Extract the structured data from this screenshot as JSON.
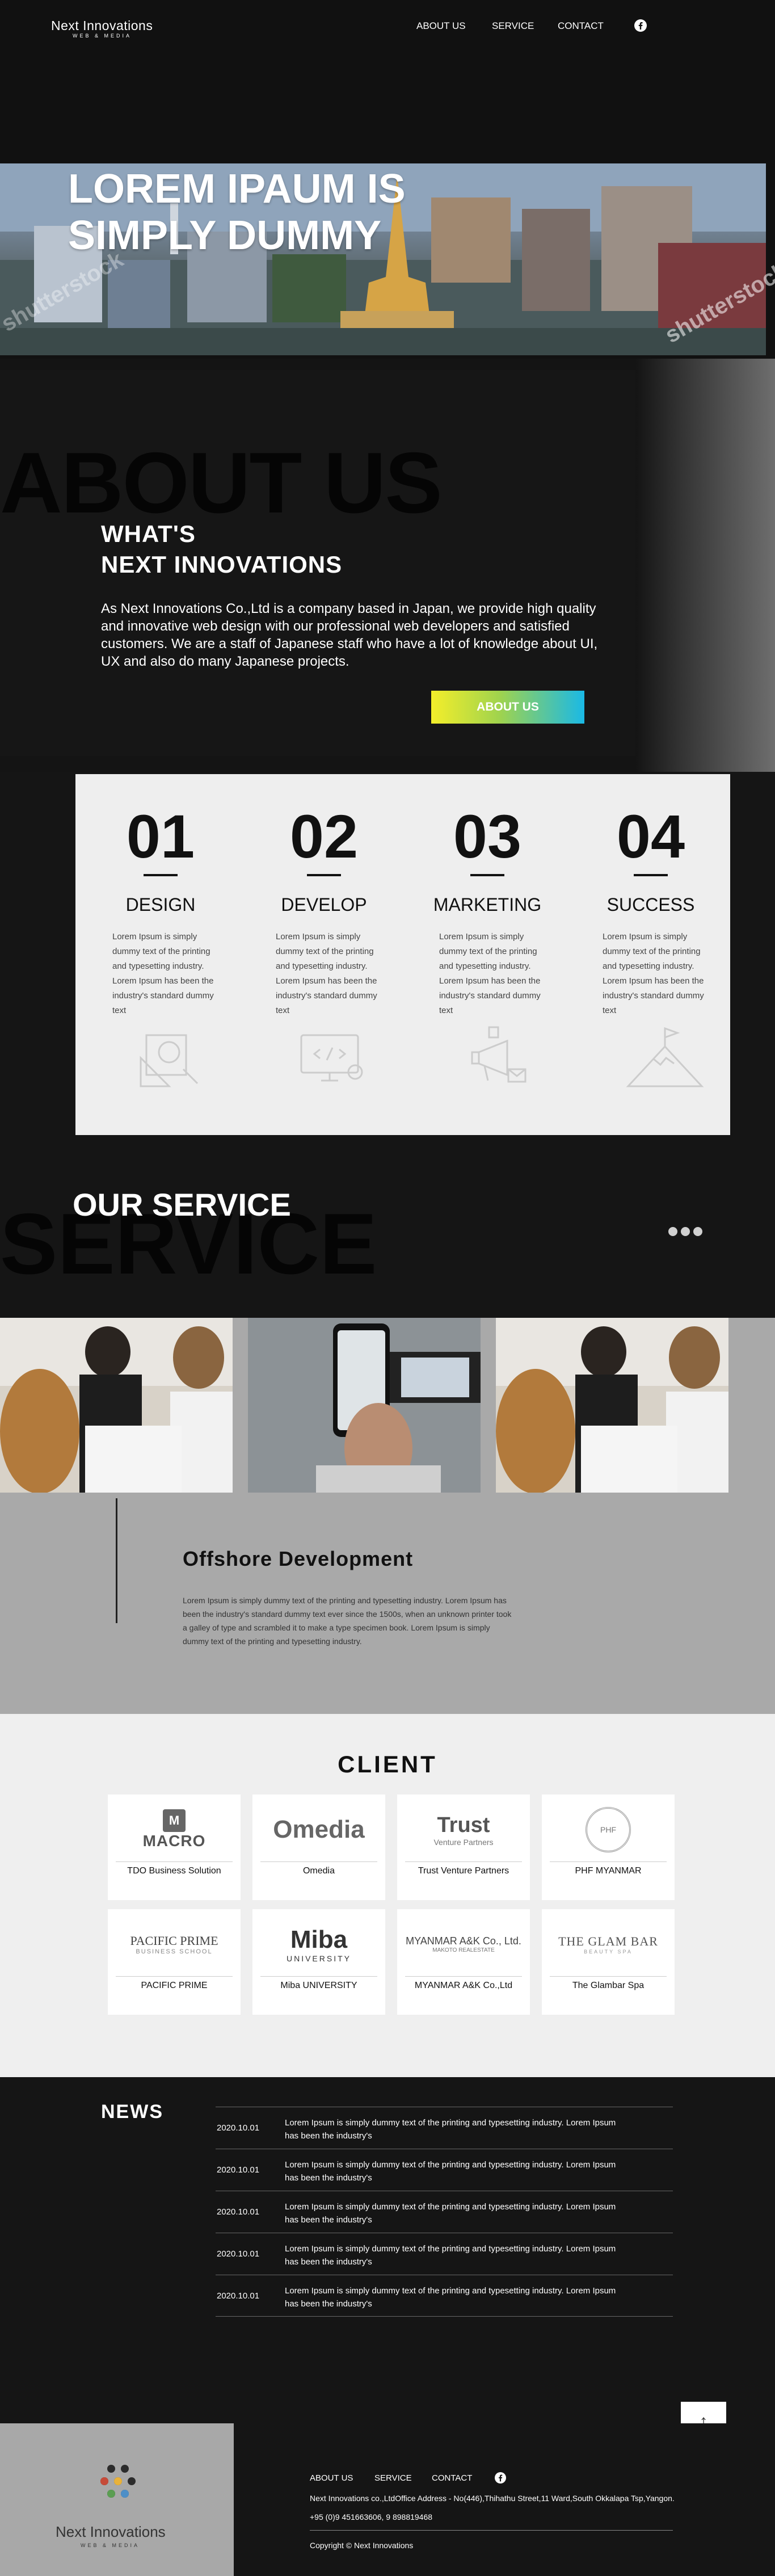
{
  "header": {
    "logo": "Next Innovations",
    "logo_sub": "WEB & MEDIA",
    "nav": [
      "ABOUT US",
      "SERVICE",
      "CONTACT"
    ]
  },
  "hero": {
    "title_line1": "LOREM IPAUM IS",
    "title_line2": "SIMPLY DUMMY",
    "watermark": "shutterstock"
  },
  "about": {
    "bg_text": "ABOUT US",
    "heading_line1": "WHAT'S",
    "heading_line2": "NEXT INNOVATIONS",
    "text": "As Next Innovations Co.,Ltd is a company based in Japan, we provide high quality and innovative web design with our professional web developers and satisfied customers. We are a staff of Japanese staff who have a lot of knowledge about UI, UX and also do many Japanese projects.",
    "button": "ABOUT US"
  },
  "steps": [
    {
      "num": "01",
      "title": "DESIGN",
      "text": "Lorem Ipsum is simply dummy text of the printing and typesetting industry. Lorem Ipsum has been the industry's standard dummy text"
    },
    {
      "num": "02",
      "title": "DEVELOP",
      "text": "Lorem Ipsum is simply dummy text of the printing and typesetting industry. Lorem Ipsum has been the industry's standard dummy text"
    },
    {
      "num": "03",
      "title": "MARKETING",
      "text": "Lorem Ipsum is simply dummy text of the printing and typesetting industry. Lorem Ipsum has been the industry's standard dummy text"
    },
    {
      "num": "04",
      "title": "SUCCESS",
      "text": "Lorem Ipsum is simply dummy text of the printing and typesetting industry. Lorem Ipsum has been the industry's standard dummy text"
    }
  ],
  "service": {
    "bg_text": "SERVICE",
    "title": "OUR SERVICE",
    "offshore_title": "Offshore Development",
    "offshore_text": "Lorem Ipsum is simply dummy text of the printing and typesetting industry. Lorem Ipsum has been the industry's standard dummy text ever since the 1500s, when an unknown printer took a galley of type and scrambled it to make a type specimen book. Lorem Ipsum is simply dummy text of the printing and typesetting industry."
  },
  "client": {
    "title": "CLIENT",
    "items": [
      {
        "name": "TDO Business Solution",
        "logo": "MACRO"
      },
      {
        "name": "Omedia",
        "logo": "Omedia"
      },
      {
        "name": "Trust Venture Partners",
        "logo": "Trust",
        "logo_sub": "Venture Partners"
      },
      {
        "name": "PHF MYANMAR",
        "logo": "PHF"
      },
      {
        "name": "PACIFIC PRIME",
        "logo": "PACIFIC PRIME",
        "logo_sub": "BUSINESS SCHOOL"
      },
      {
        "name": "Miba UNIVERSITY",
        "logo": "Miba",
        "logo_sub": "UNIVERSITY"
      },
      {
        "name": "MYANMAR A&K Co.,Ltd",
        "logo": "MYANMAR A&K Co., Ltd.",
        "logo_sub": "MAKOTO REALESTATE"
      },
      {
        "name": "The Glambar Spa",
        "logo": "THE GLAM BAR",
        "logo_sub": "BEAUTY SPA"
      }
    ]
  },
  "news": {
    "title": "NEWS",
    "items": [
      {
        "date": "2020.10.01",
        "text": "Lorem Ipsum is simply dummy text of the printing and typesetting industry. Lorem Ipsum has been the industry's"
      },
      {
        "date": "2020.10.01",
        "text": "Lorem Ipsum is simply dummy text of the printing and typesetting industry. Lorem Ipsum has been the industry's"
      },
      {
        "date": "2020.10.01",
        "text": "Lorem Ipsum is simply dummy text of the printing and typesetting industry. Lorem Ipsum has been the industry's"
      },
      {
        "date": "2020.10.01",
        "text": "Lorem Ipsum is simply dummy text of the printing and typesetting industry. Lorem Ipsum has been the industry's"
      },
      {
        "date": "2020.10.01",
        "text": "Lorem Ipsum is simply dummy text of the printing and typesetting industry. Lorem Ipsum has been the industry's"
      }
    ],
    "to_top": "↑"
  },
  "footer": {
    "logo": "Next Innovations",
    "logo_sub": "WEB & MEDIA",
    "nav": [
      "ABOUT US",
      "SERVICE",
      "CONTACT"
    ],
    "address": "Next Innovations co.,LtdOffice Address - No(446),Thihathu Street,11 Ward,South Okkalapa Tsp,Yangon.",
    "phone": "+95 (0)9 451663606, 9 898819468",
    "copyright": "Copyright © Next Innovations"
  },
  "colors": {
    "accent_gradient": [
      "#f4ee2a",
      "#9fd34e",
      "#1ab9e6"
    ],
    "dark": "#151515",
    "light": "#eeeeee",
    "grey": "#a9a9a9"
  },
  "icons": [
    "facebook-icon",
    "design-tools-icon",
    "code-monitor-icon",
    "megaphone-icon",
    "mountain-flag-icon",
    "arrow-up-icon"
  ]
}
